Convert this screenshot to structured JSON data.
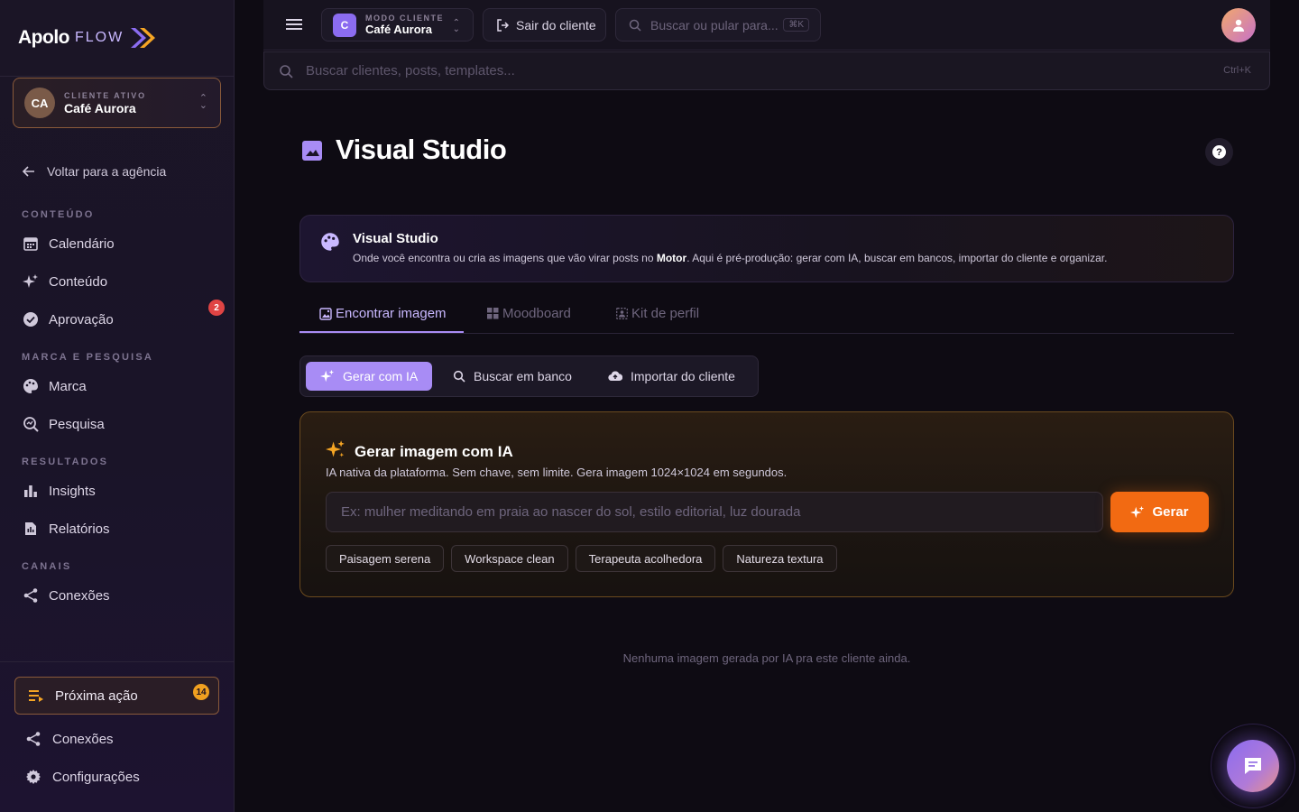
{
  "app": {
    "brand": "Apolo",
    "brand_sub": "FLOW"
  },
  "sidebar": {
    "client": {
      "initials": "CA",
      "eyebrow": "CLIENTE ATIVO",
      "name": "Café Aurora"
    },
    "back_label": "Voltar para a agência",
    "sections": [
      {
        "label": "CONTEÚDO",
        "items": [
          {
            "label": "Calendário",
            "icon": "calendar-icon"
          },
          {
            "label": "Conteúdo",
            "icon": "sparkle-icon"
          },
          {
            "label": "Aprovação",
            "icon": "check-circle-icon",
            "badge": "2"
          }
        ]
      },
      {
        "label": "MARCA E PESQUISA",
        "items": [
          {
            "label": "Marca",
            "icon": "palette-icon"
          },
          {
            "label": "Pesquisa",
            "icon": "research-icon"
          }
        ]
      },
      {
        "label": "RESULTADOS",
        "items": [
          {
            "label": "Insights",
            "icon": "bar-chart-icon"
          },
          {
            "label": "Relatórios",
            "icon": "report-icon"
          }
        ]
      },
      {
        "label": "CANAIS",
        "items": [
          {
            "label": "Conexões",
            "icon": "share-icon"
          }
        ]
      }
    ],
    "next_action": {
      "label": "Próxima ação",
      "badge": "14"
    },
    "bottom": [
      {
        "label": "Conexões",
        "icon": "share-icon"
      },
      {
        "label": "Configurações",
        "icon": "gear-icon"
      }
    ]
  },
  "topbar": {
    "mode": {
      "letter": "C",
      "eyebrow": "MODO CLIENTE",
      "name": "Café Aurora"
    },
    "exit_label": "Sair do cliente",
    "search_placeholder": "Buscar ou pular para...",
    "search_kbd": "⌘K",
    "global_search_placeholder": "Buscar clientes, posts, templates...",
    "global_search_kbd": "Ctrl+K"
  },
  "page": {
    "title": "Visual Studio",
    "help": "?",
    "info": {
      "title": "Visual Studio",
      "desc_pre": "Onde você encontra ou cria as imagens que vão virar posts no ",
      "desc_bold": "Motor",
      "desc_post": ". Aqui é pré-produção: gerar com IA, buscar em bancos, importar do cliente e organizar."
    },
    "tabs": [
      "Encontrar imagem",
      "Moodboard",
      "Kit de perfil"
    ],
    "segments": [
      "Gerar com IA",
      "Buscar em banco",
      "Importar do cliente"
    ],
    "generator": {
      "title": "Gerar imagem com IA",
      "subtitle": "IA nativa da plataforma. Sem chave, sem limite. Gera imagem 1024×1024 em segundos.",
      "placeholder": "Ex: mulher meditando em praia ao nascer do sol, estilo editorial, luz dourada",
      "button": "Gerar",
      "chips": [
        "Paisagem serena",
        "Workspace clean",
        "Terapeuta acolhedora",
        "Natureza textura"
      ]
    },
    "empty_message": "Nenhuma imagem gerada por IA pra este cliente ainda."
  },
  "colors": {
    "accent": "#a88cf5",
    "orange": "#f26a12",
    "badge_red": "#e04444",
    "badge_orange": "#f0a020"
  }
}
